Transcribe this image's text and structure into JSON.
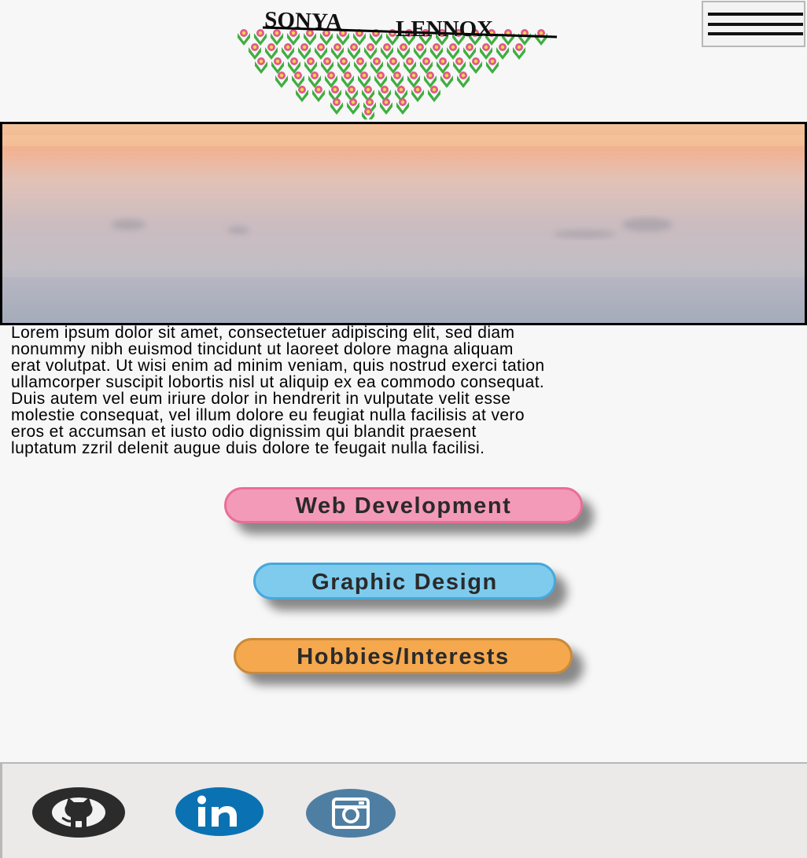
{
  "header": {
    "logo": {
      "first_name": "SONYA",
      "last_name": "LENNOX",
      "icon": "flower-garden-logo"
    },
    "menu": {
      "icon": "hamburger-menu-icon"
    }
  },
  "hero": {
    "icon": "misty-sunrise-landscape"
  },
  "intro": {
    "lines": [
      "Lorem ipsum dolor sit amet, consectetuer adipiscing elit, sed diam",
      "nonummy nibh euismod tincidunt ut laoreet dolore magna aliquam",
      "erat volutpat. Ut wisi enim ad minim veniam, quis nostrud exerci tation",
      "ullamcorper suscipit lobortis nisl ut aliquip ex ea commodo consequat.",
      "Duis autem vel eum iriure dolor in hendrerit in vulputate velit esse",
      "molestie consequat, vel illum dolore eu feugiat nulla facilisis at vero",
      "eros et accumsan et iusto odio dignissim qui blandit praesent",
      "luptatum zzril delenit augue duis dolore te feugait nulla facilisi."
    ]
  },
  "nav": [
    {
      "label": "Web Development",
      "color": "#f49ab9"
    },
    {
      "label": "Graphic Design",
      "color": "#7ecbee"
    },
    {
      "label": "Hobbies/Interests",
      "color": "#f5a84e"
    }
  ],
  "footer": {
    "social": [
      {
        "icon": "github-icon",
        "color": "#2b2b2b"
      },
      {
        "icon": "linkedin-icon",
        "color": "#0a72b2"
      },
      {
        "icon": "instagram-icon",
        "color": "#4e7fa3"
      }
    ]
  }
}
